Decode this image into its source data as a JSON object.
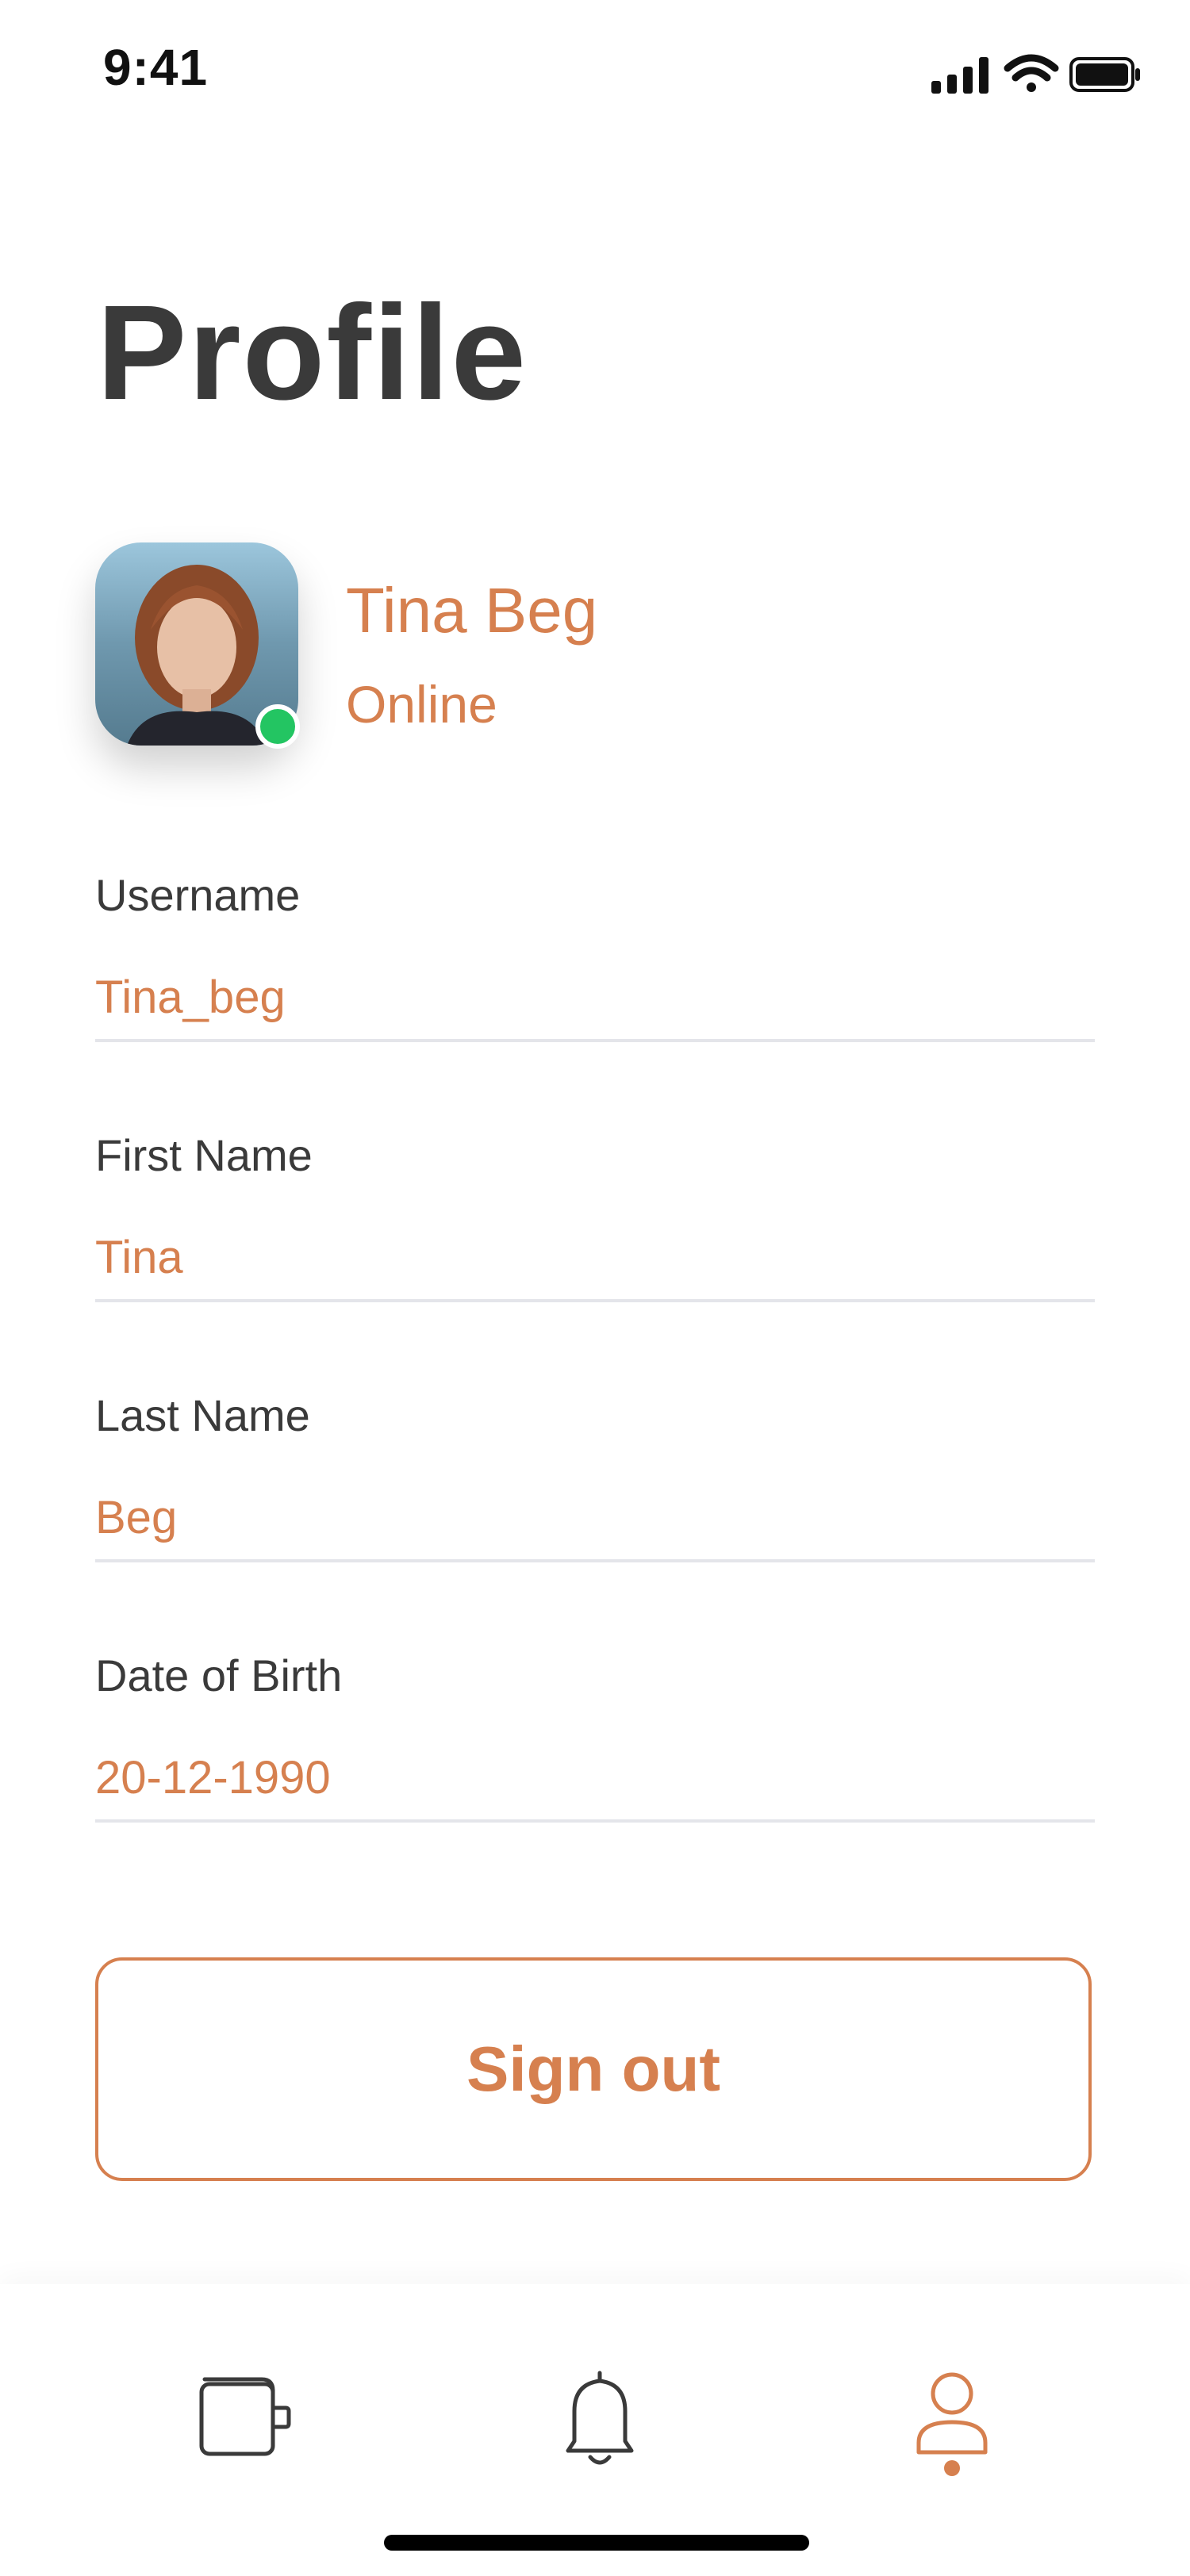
{
  "status_bar": {
    "time": "9:41"
  },
  "page": {
    "title": "Profile"
  },
  "profile": {
    "name": "Tina Beg",
    "status": "Online",
    "status_color": "#23c562"
  },
  "fields": [
    {
      "label": "Username",
      "value": "Tina_beg"
    },
    {
      "label": "First Name",
      "value": "Tina"
    },
    {
      "label": "Last Name",
      "value": "Beg"
    },
    {
      "label": "Date of Birth",
      "value": "20-12-1990"
    }
  ],
  "actions": {
    "sign_out_label": "Sign out"
  },
  "tab_bar": {
    "items": [
      {
        "icon": "wallet-icon",
        "active": false
      },
      {
        "icon": "bell-icon",
        "active": false
      },
      {
        "icon": "user-icon",
        "active": true
      }
    ]
  },
  "colors": {
    "accent": "#d6804f",
    "text": "#3a3a3a",
    "divider": "#e4e5ea",
    "online": "#23c562"
  }
}
